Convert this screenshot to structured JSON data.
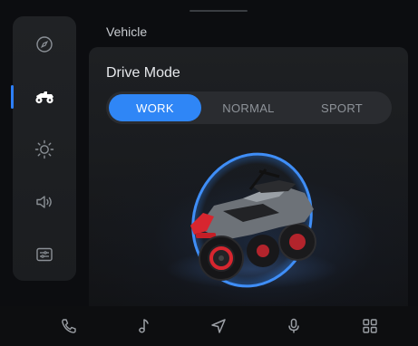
{
  "header": {
    "section_label": "Vehicle"
  },
  "sidebar": {
    "items": [
      {
        "icon": "compass-icon",
        "active": false
      },
      {
        "icon": "atv-icon",
        "active": true
      },
      {
        "icon": "brightness-icon",
        "active": false
      },
      {
        "icon": "volume-icon",
        "active": false
      },
      {
        "icon": "settings-list-icon",
        "active": false
      }
    ]
  },
  "drive_mode": {
    "title": "Drive Mode",
    "options": [
      "WORK",
      "NORMAL",
      "SPORT"
    ],
    "selected": "WORK"
  },
  "dock": {
    "items": [
      "phone-icon",
      "music-icon",
      "navigation-icon",
      "microphone-icon",
      "apps-grid-icon"
    ]
  },
  "colors": {
    "accent": "#2f86f6",
    "background": "#0c0d10",
    "panel": "#1e2023",
    "vehicle_red": "#d7262f"
  }
}
